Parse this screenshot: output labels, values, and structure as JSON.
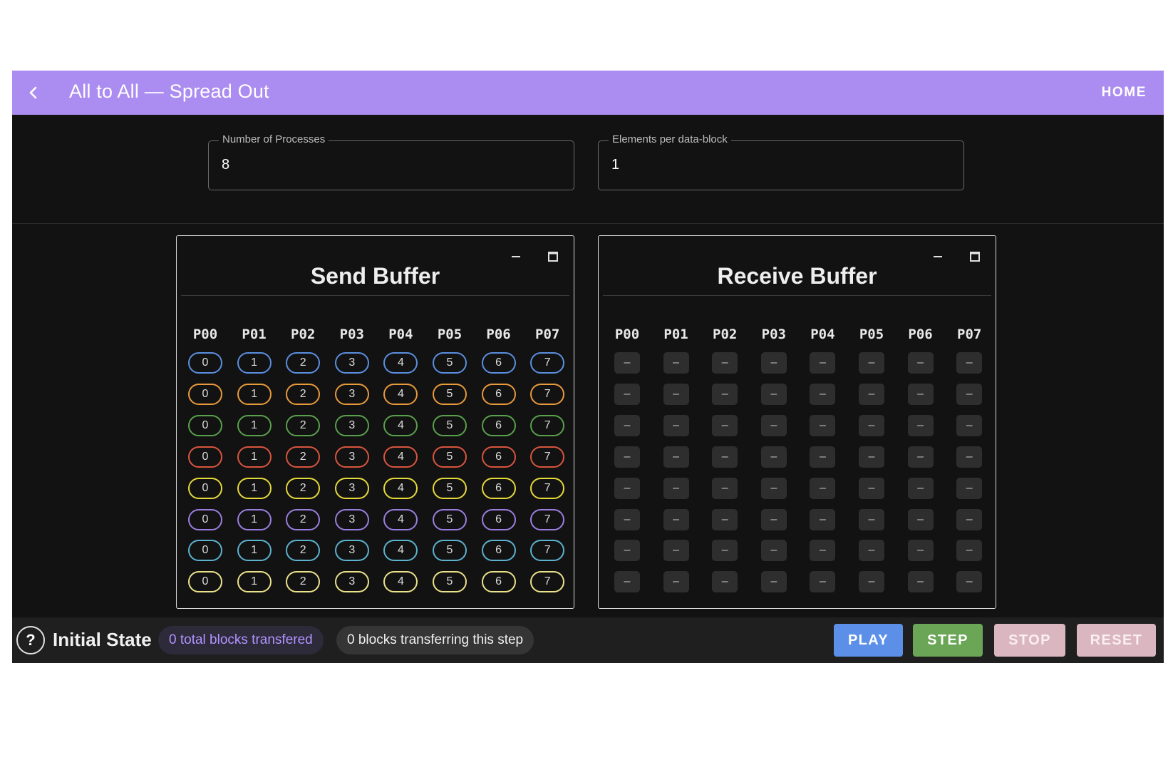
{
  "header": {
    "title": "All to All — Spread Out",
    "home_label": "HOME",
    "accent_color": "#ab8cf0",
    "back_icon": "chevron-left-icon"
  },
  "controls": {
    "processes": {
      "label": "Number of Processes",
      "value": "8"
    },
    "elements": {
      "label": "Elements per data-block",
      "value": "1"
    }
  },
  "send_buffer": {
    "title": "Send Buffer",
    "columns": [
      "P00",
      "P01",
      "P02",
      "P03",
      "P04",
      "P05",
      "P06",
      "P07"
    ],
    "row_colors": [
      "#5b8fe0",
      "#e89a3c",
      "#59a04c",
      "#d9553e",
      "#e6d93a",
      "#9b7ee0",
      "#5cb2cf",
      "#ece28a"
    ],
    "cells": [
      [
        "0",
        "1",
        "2",
        "3",
        "4",
        "5",
        "6",
        "7"
      ],
      [
        "0",
        "1",
        "2",
        "3",
        "4",
        "5",
        "6",
        "7"
      ],
      [
        "0",
        "1",
        "2",
        "3",
        "4",
        "5",
        "6",
        "7"
      ],
      [
        "0",
        "1",
        "2",
        "3",
        "4",
        "5",
        "6",
        "7"
      ],
      [
        "0",
        "1",
        "2",
        "3",
        "4",
        "5",
        "6",
        "7"
      ],
      [
        "0",
        "1",
        "2",
        "3",
        "4",
        "5",
        "6",
        "7"
      ],
      [
        "0",
        "1",
        "2",
        "3",
        "4",
        "5",
        "6",
        "7"
      ],
      [
        "0",
        "1",
        "2",
        "3",
        "4",
        "5",
        "6",
        "7"
      ]
    ]
  },
  "receive_buffer": {
    "title": "Receive Buffer",
    "columns": [
      "P00",
      "P01",
      "P02",
      "P03",
      "P04",
      "P05",
      "P06",
      "P07"
    ],
    "cells": [
      [
        "–",
        "–",
        "–",
        "–",
        "–",
        "–",
        "–",
        "–"
      ],
      [
        "–",
        "–",
        "–",
        "–",
        "–",
        "–",
        "–",
        "–"
      ],
      [
        "–",
        "–",
        "–",
        "–",
        "–",
        "–",
        "–",
        "–"
      ],
      [
        "–",
        "–",
        "–",
        "–",
        "–",
        "–",
        "–",
        "–"
      ],
      [
        "–",
        "–",
        "–",
        "–",
        "–",
        "–",
        "–",
        "–"
      ],
      [
        "–",
        "–",
        "–",
        "–",
        "–",
        "–",
        "–",
        "–"
      ],
      [
        "–",
        "–",
        "–",
        "–",
        "–",
        "–",
        "–",
        "–"
      ],
      [
        "–",
        "–",
        "–",
        "–",
        "–",
        "–",
        "–",
        "–"
      ]
    ]
  },
  "status": {
    "state": "Initial State",
    "total_chip": "0 total blocks transfered",
    "step_chip": "0 blocks transferring this step",
    "help_label": "?"
  },
  "buttons": {
    "play": "PLAY",
    "step": "STEP",
    "stop": "STOP",
    "reset": "RESET"
  }
}
